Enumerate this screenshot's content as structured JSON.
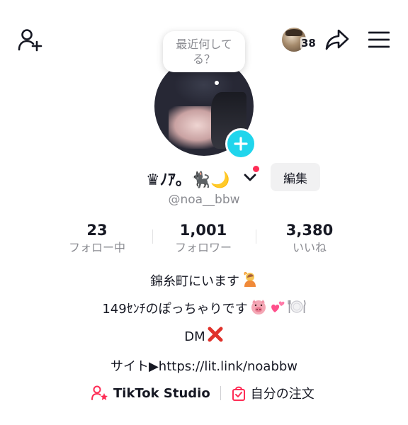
{
  "topbar": {
    "friends_count": "38"
  },
  "bubble": {
    "text": "最近何してる？"
  },
  "profile": {
    "display_name": "♛ﾉｱ。🐈‍⬛🌙",
    "username": "@noa__bbw",
    "edit_label": "編集"
  },
  "stats": [
    {
      "value": "23",
      "label": "フォロー中"
    },
    {
      "value": "1,001",
      "label": "フォロワー"
    },
    {
      "value": "3,380",
      "label": "いいね"
    }
  ],
  "bio": {
    "line1": "錦糸町にいます",
    "line2": "149ｾﾝﾁのぽっちゃりです",
    "line3": "DM"
  },
  "site_link": "サイト▶https://lit.link/noabbw",
  "links": {
    "studio": "TikTok Studio",
    "orders": "自分の注文"
  },
  "colors": {
    "accent_cyan": "#20d5ec",
    "accent_red": "#fe2c55",
    "text_primary": "#161823",
    "text_secondary": "#8a8b91"
  }
}
